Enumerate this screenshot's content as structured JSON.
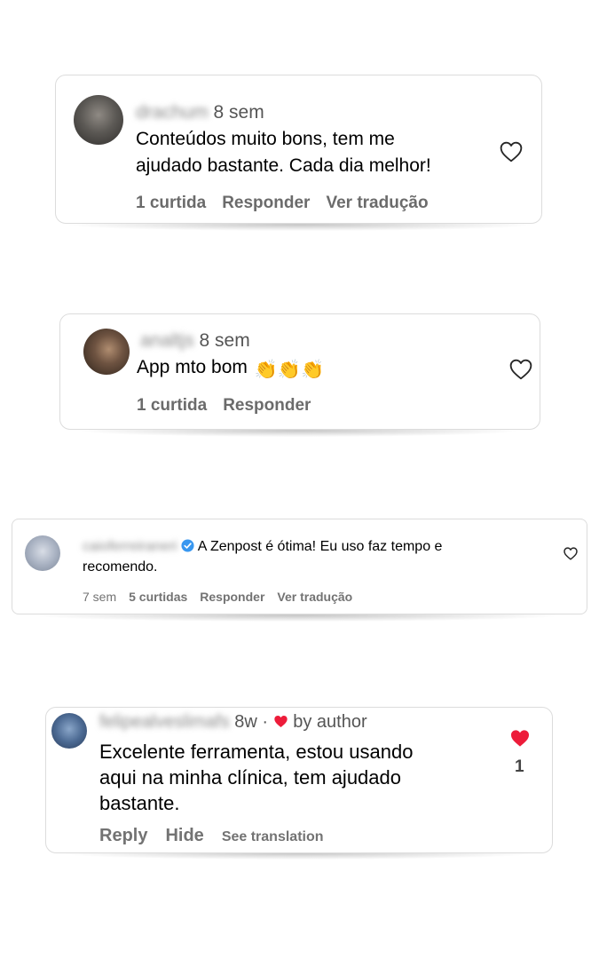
{
  "comments": [
    {
      "username": "drachum",
      "time": "8 sem",
      "text_lines": [
        "Conteúdos muito bons, tem me",
        "ajudado bastante. Cada dia melhor!"
      ],
      "likes": "1 curtida",
      "reply": "Responder",
      "translate": "Ver tradução"
    },
    {
      "username": "analtjs",
      "time": "8 sem",
      "text": "App mto bom",
      "emoji": "👏👏👏",
      "likes": "1 curtida",
      "reply": "Responder"
    },
    {
      "username": "caioferreiraneri",
      "text_line1": "A Zenpost é ótima! Eu uso faz tempo e",
      "text_line2": "recomendo.",
      "time": "7 sem",
      "likes": "5 curtidas",
      "reply": "Responder",
      "translate": "Ver tradução"
    },
    {
      "username": "felipealveslimafs",
      "time": "8w ·",
      "by_author": "by author",
      "text_lines": [
        "Excelente ferramenta, estou usando",
        "aqui na minha clínica, tem ajudado",
        "bastante."
      ],
      "like_count": "1",
      "reply": "Reply",
      "hide": "Hide",
      "translate": "See translation"
    }
  ],
  "colors": {
    "liked_heart": "#ed1c3a",
    "verified": "#3897f0",
    "secondary_text": "#6b6b6b"
  },
  "icons": [
    "heart-outline-icon",
    "heart-filled-icon",
    "verified-badge-icon",
    "clapping-hands-emoji"
  ]
}
